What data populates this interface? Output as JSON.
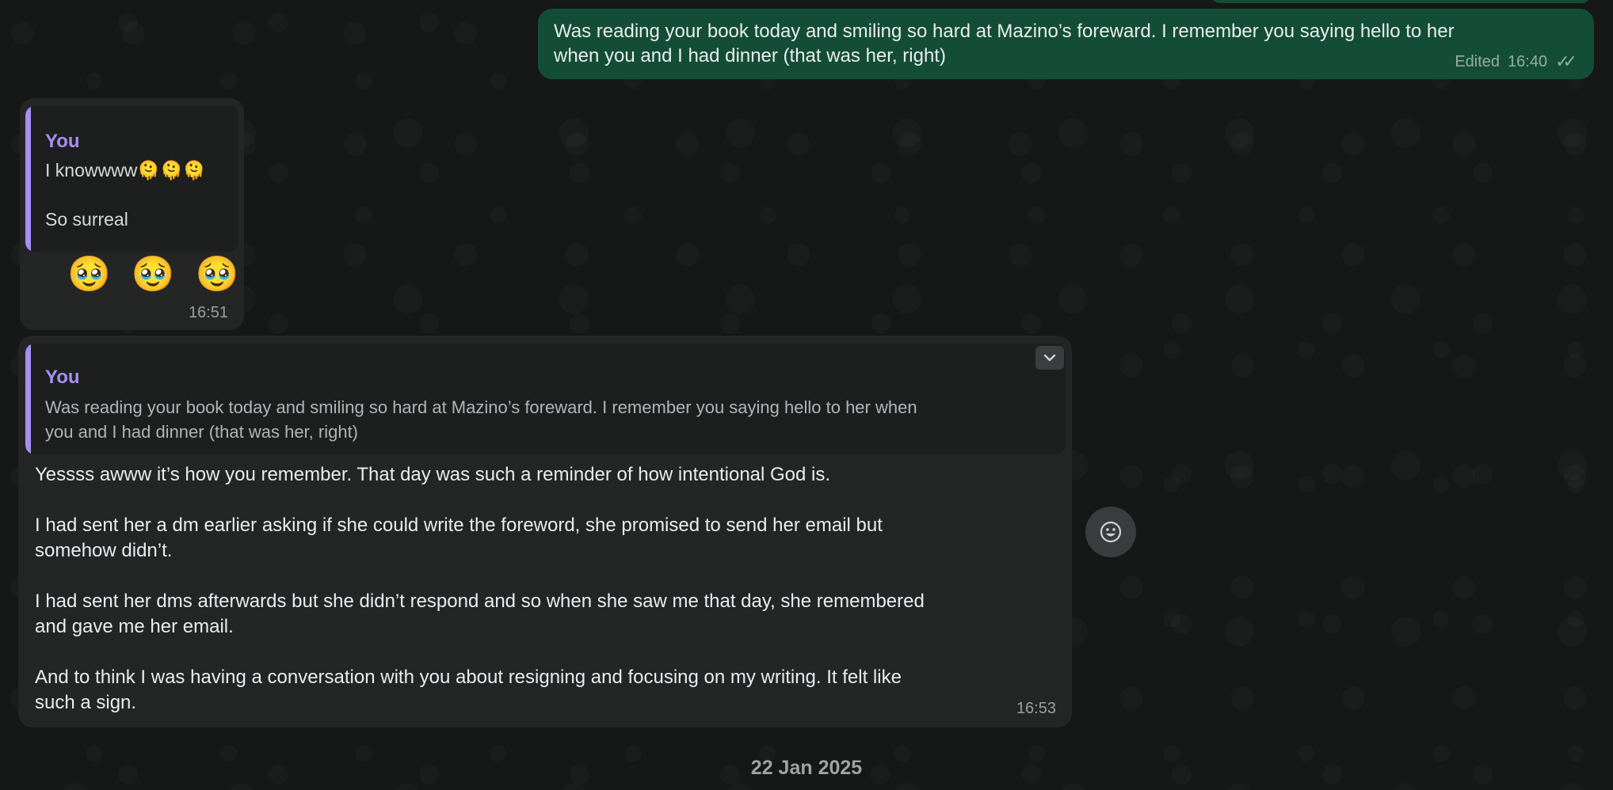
{
  "colors": {
    "background": "#161717",
    "outgoing_bubble": "#144d37",
    "incoming_bubble": "#242626",
    "quote_background": "#1d1f1f",
    "quote_accent": "#a98ef5"
  },
  "messages": [
    {
      "direction": "outgoing",
      "text": "Was reading your book today and smiling so hard at Mazino’s foreward. I remember you saying hello to her\nwhen you and I had dinner (that was her, right)",
      "edited_label": "Edited",
      "time": "16:40",
      "status_icon": "double-check-icon"
    },
    {
      "direction": "incoming",
      "quote_author": "You",
      "quote_text": "I knowwww🫠🫠🫠\n\nSo surreal",
      "reaction_text": "🥹 🥹 🥹",
      "time": "16:51"
    },
    {
      "direction": "incoming",
      "quote_author": "You",
      "quote_text": "Was reading your book today and smiling so hard at Mazino’s foreward. I remember you saying hello to her when\nyou and I had dinner (that was her, right)",
      "text": "Yessss awww it’s how you remember. That day was such a reminder of how intentional God is.\n\nI had sent her a dm earlier asking if she could write the foreword, she promised to send her email but\nsomehow didn’t.\n\nI had sent her dms afterwards but she didn’t respond and so when she saw me that day, she remembered\nand gave me her email.\n\nAnd to think I was having a conversation with you about resigning and focusing on my writing. It felt like\nsuch a sign.",
      "time": "16:53",
      "menu_icon": "chevron-down-icon"
    }
  ],
  "reaction_button_icon": "smiley-icon",
  "date_separator": "22 Jan 2025"
}
